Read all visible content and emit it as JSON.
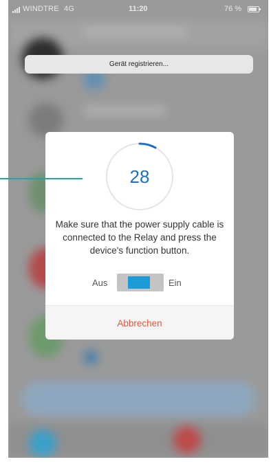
{
  "status_bar": {
    "carrier": "WINDTRE",
    "network": "4G",
    "time": "11:20",
    "battery": "76 %",
    "battery_level": 0.76
  },
  "toast": {
    "text": "Gerät registrieren..."
  },
  "dialog": {
    "countdown": "28",
    "progress_fraction": 0.08,
    "message": "Make sure that the power supply cable is connected to the Relay and press the device's function button.",
    "toggle": {
      "off_label": "Aus",
      "on_label": "Ein"
    },
    "cancel_label": "Abbrechen"
  },
  "colors": {
    "accent_blue": "#1f6fc4",
    "toggle_blue": "#1b9bd8",
    "cancel_red": "#e3553c",
    "callout_teal": "#1fa5a5"
  },
  "icons": {
    "signal": "signal-bars-icon",
    "battery": "battery-icon",
    "progress": "progress-ring-icon"
  }
}
